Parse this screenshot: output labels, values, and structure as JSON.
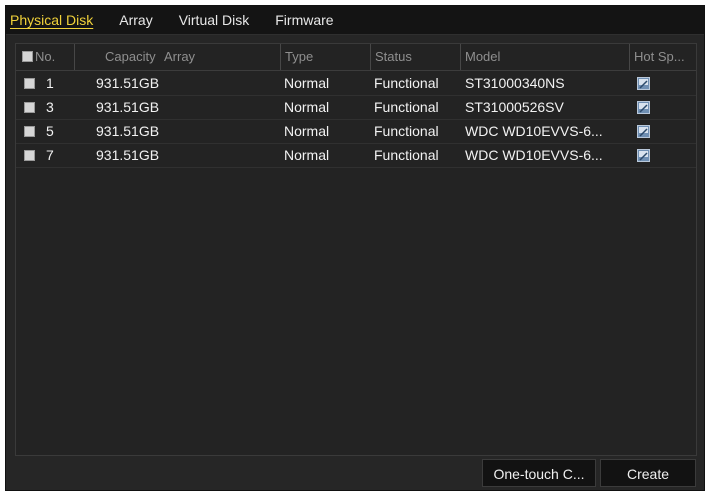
{
  "tabs": [
    {
      "label": "Physical Disk",
      "active": true
    },
    {
      "label": "Array",
      "active": false
    },
    {
      "label": "Virtual Disk",
      "active": false
    },
    {
      "label": "Firmware",
      "active": false
    }
  ],
  "table": {
    "columns": [
      "No.",
      "Capacity",
      "Array",
      "Type",
      "Status",
      "Model",
      "Hot Sp..."
    ],
    "rows": [
      {
        "no": "1",
        "capacity": "931.51GB",
        "array": "",
        "type": "Normal",
        "status": "Functional",
        "model": "ST31000340NS",
        "hot_spare_icon": "disk-edit-icon"
      },
      {
        "no": "3",
        "capacity": "931.51GB",
        "array": "",
        "type": "Normal",
        "status": "Functional",
        "model": "ST31000526SV",
        "hot_spare_icon": "disk-edit-icon"
      },
      {
        "no": "5",
        "capacity": "931.51GB",
        "array": "",
        "type": "Normal",
        "status": "Functional",
        "model": "WDC WD10EVVS-6...",
        "hot_spare_icon": "disk-edit-icon"
      },
      {
        "no": "7",
        "capacity": "931.51GB",
        "array": "",
        "type": "Normal",
        "status": "Functional",
        "model": "WDC WD10EVVS-6...",
        "hot_spare_icon": "disk-edit-icon"
      }
    ]
  },
  "buttons": {
    "one_touch": "One-touch C...",
    "create": "Create"
  },
  "colors": {
    "active_tab": "#f1d23a",
    "panel": "#262626",
    "button": "#121212"
  }
}
